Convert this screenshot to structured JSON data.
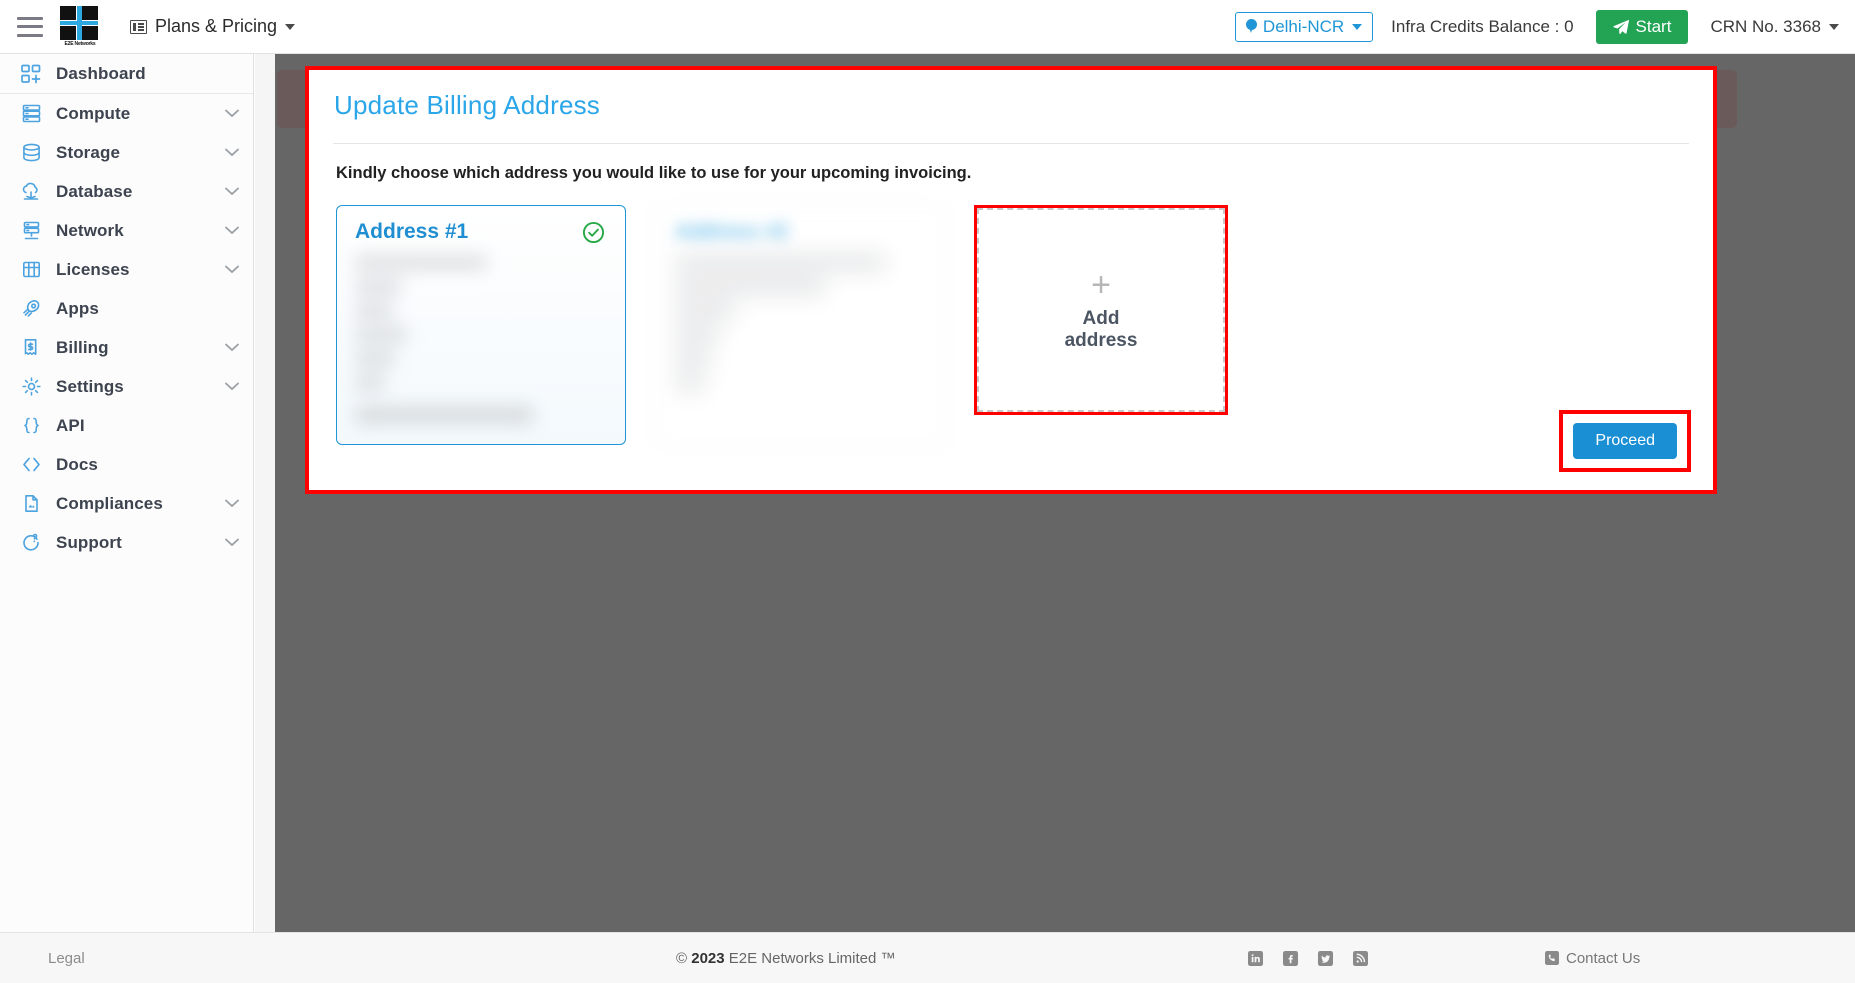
{
  "topbar": {
    "menu_icon": "hamburger-icon",
    "logo_alt": "E2E Networks",
    "logo_caption": "E2E Networks",
    "plans_label": "Plans & Pricing",
    "region_label": "Delhi-NCR",
    "credits_label": "Infra Credits Balance : 0",
    "start_label": "Start",
    "crn_label": "CRN No. 3368"
  },
  "sidebar": {
    "items": [
      {
        "label": "Dashboard",
        "icon": "dashboard-icon",
        "expandable": false
      },
      {
        "label": "Compute",
        "icon": "server-icon",
        "expandable": true
      },
      {
        "label": "Storage",
        "icon": "database-icon",
        "expandable": true
      },
      {
        "label": "Database",
        "icon": "cloud-db-icon",
        "expandable": true
      },
      {
        "label": "Network",
        "icon": "network-icon",
        "expandable": true
      },
      {
        "label": "Licenses",
        "icon": "license-grid-icon",
        "expandable": true
      },
      {
        "label": "Apps",
        "icon": "rocket-icon",
        "expandable": false
      },
      {
        "label": "Billing",
        "icon": "invoice-icon",
        "expandable": true
      },
      {
        "label": "Settings",
        "icon": "gear-icon",
        "expandable": true
      },
      {
        "label": "API",
        "icon": "braces-icon",
        "expandable": false
      },
      {
        "label": "Docs",
        "icon": "code-icon",
        "expandable": false
      },
      {
        "label": "Compliances",
        "icon": "document-icon",
        "expandable": true
      },
      {
        "label": "Support",
        "icon": "lifebuoy-icon",
        "expandable": true
      }
    ]
  },
  "modal": {
    "title": "Update Billing Address",
    "subtitle": "Kindly choose which address you would like to use for your upcoming invoicing.",
    "cards": [
      {
        "title": "Address #1",
        "selected": true,
        "redacted": true
      },
      {
        "title": "Address #2",
        "selected": false,
        "redacted": true
      }
    ],
    "add_card": {
      "plus": "+",
      "label_line1": "Add",
      "label_line2": "address"
    },
    "proceed_label": "Proceed"
  },
  "footer": {
    "legal": "Legal",
    "copyright_symbol": "©",
    "copyright_year": "2023",
    "copyright_text": "E2E Networks Limited ™",
    "social": [
      "linkedin-icon",
      "facebook-icon",
      "twitter-icon",
      "rss-icon"
    ],
    "contact": "Contact Us"
  },
  "colors": {
    "accent_blue": "#2196d6",
    "title_blue": "#2ba6e8",
    "start_green": "#23a455",
    "annotation_red": "#ff0000",
    "overlay_gray": "#666666"
  }
}
